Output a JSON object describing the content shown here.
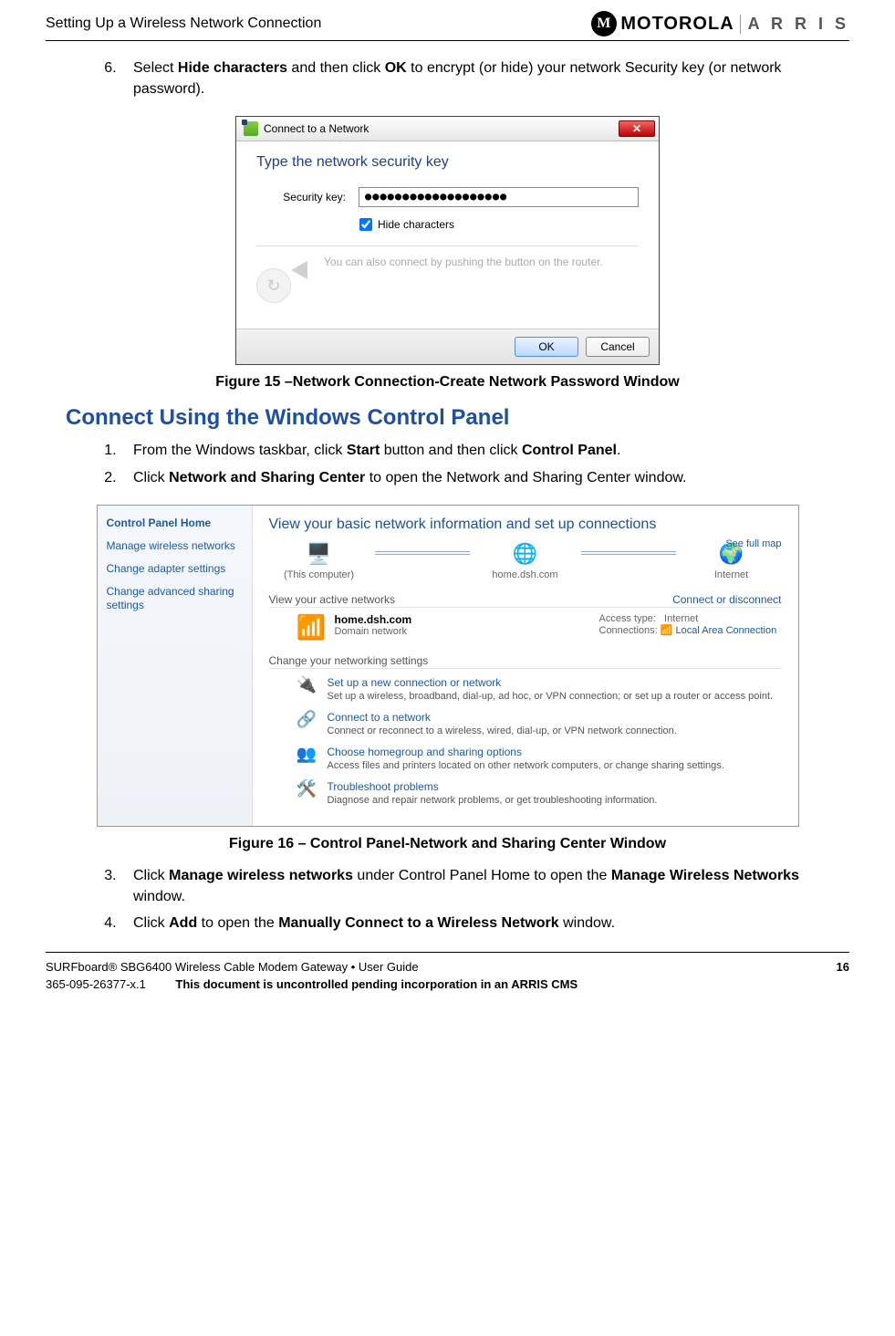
{
  "header": {
    "title": "Setting Up a Wireless Network Connection",
    "logo1": "MOTOROLA",
    "logo2": "A R R I S"
  },
  "step6": {
    "num": "6.",
    "pre": "Select ",
    "hide": "Hide characters",
    "mid1": " and then click ",
    "ok": "OK",
    "post": " to encrypt (or hide) your network Security key (or network password)."
  },
  "dialog1": {
    "title": "Connect to a Network",
    "heading": "Type the network security key",
    "label": "Security key:",
    "value": "●●●●●●●●●●●●●●●●●●●",
    "hide": "Hide characters",
    "wps": "You can also connect by pushing the button on the router.",
    "refresh_glyph": "↻",
    "ok": "OK",
    "cancel": "Cancel",
    "close_glyph": "✕"
  },
  "figure15": "Figure 15 –Network Connection-Create Network Password Window",
  "section": "Connect Using the Windows Control Panel",
  "step1": {
    "num": "1.",
    "pre": "From the Windows taskbar, click ",
    "start": "Start",
    "mid": " button and then click ",
    "cp": "Control Panel",
    "post": "."
  },
  "step2": {
    "num": "2.",
    "pre": "Click ",
    "nsc": "Network and Sharing Center",
    "post": " to open the Network and Sharing Center window."
  },
  "panel2": {
    "side": {
      "home": "Control Panel Home",
      "links": [
        "Manage wireless networks",
        "Change adapter settings",
        "Change advanced sharing settings"
      ]
    },
    "heading": "View your basic network information and set up connections",
    "fullmap": "See full map",
    "map": {
      "pc": "(This computer)",
      "home": "home.dsh.com",
      "internet": "Internet",
      "pc_glyph": "🖥️",
      "net_glyph": "🌐",
      "globe_glyph": "🌍"
    },
    "active_heading": "View your active networks",
    "connect_link": "Connect or disconnect",
    "active": {
      "name": "home.dsh.com",
      "type": "Domain network",
      "access_label": "Access type:",
      "access_value": "Internet",
      "conn_label": "Connections:",
      "conn_value": "Local Area Connection",
      "icon": "📶"
    },
    "change_heading": "Change your networking settings",
    "items": [
      {
        "icon": "🔌",
        "title": "Set up a new connection or network",
        "desc": "Set up a wireless, broadband, dial-up, ad hoc, or VPN connection; or set up a router or access point."
      },
      {
        "icon": "🔗",
        "title": "Connect to a network",
        "desc": "Connect or reconnect to a wireless, wired, dial-up, or VPN network connection."
      },
      {
        "icon": "👥",
        "title": "Choose homegroup and sharing options",
        "desc": "Access files and printers located on other network computers, or change sharing settings."
      },
      {
        "icon": "🛠️",
        "title": "Troubleshoot problems",
        "desc": "Diagnose and repair network problems, or get troubleshooting information."
      }
    ]
  },
  "figure16": "Figure 16 – Control Panel-Network and Sharing Center Window",
  "step3": {
    "num": "3.",
    "pre": "Click ",
    "mwn": "Manage wireless networks",
    "mid": " under Control Panel Home to open the ",
    "mwn2": "Manage Wireless Networks",
    "post": " window."
  },
  "step4": {
    "num": "4.",
    "pre": "Click ",
    "add": "Add",
    "mid": " to open the ",
    "mcwn": "Manually Connect to a Wireless Network",
    "post": " window."
  },
  "footer": {
    "line1_left": "SURFboard® SBG6400 Wireless Cable Modem Gateway • User Guide",
    "line1_right": "16",
    "line2_left": "365-095-26377-x.1",
    "line2_right": "This document is uncontrolled pending incorporation in an ARRIS CMS"
  }
}
